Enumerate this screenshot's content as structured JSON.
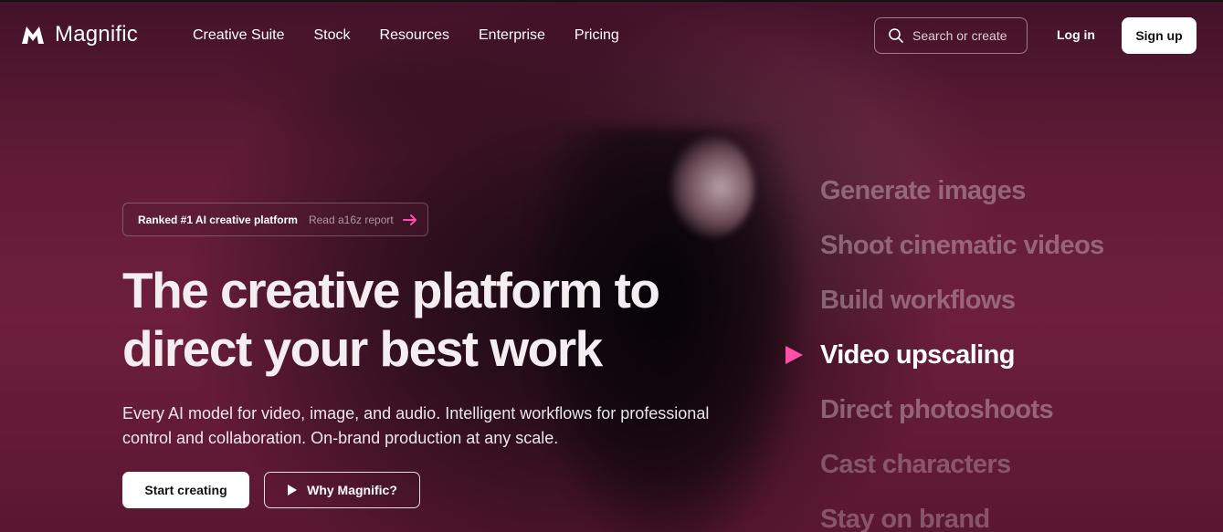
{
  "brand": {
    "name": "Magnific"
  },
  "nav": {
    "links": [
      "Creative Suite",
      "Stock",
      "Resources",
      "Enterprise",
      "Pricing"
    ],
    "search_placeholder": "Search or create",
    "login": "Log in",
    "signup": "Sign up"
  },
  "hero": {
    "badge_text": "Ranked #1 AI creative platform",
    "badge_link": "Read a16z report",
    "headline_line1": "The creative platform to",
    "headline_line2": "direct your best work",
    "subtext_line1": "Every AI model for video, image, and audio. Intelligent workflows for professional",
    "subtext_line2": "control and collaboration. On-brand production at any scale.",
    "cta_primary": "Start creating",
    "cta_secondary": "Why Magnific?"
  },
  "features": {
    "items": [
      "Generate images",
      "Shoot cinematic videos",
      "Build workflows",
      "Video upscaling",
      "Direct photoshoots",
      "Cast characters",
      "Stay on brand"
    ],
    "active_index": 3
  },
  "colors": {
    "accent": "#ff4fa8",
    "background": "#5c1a33"
  }
}
